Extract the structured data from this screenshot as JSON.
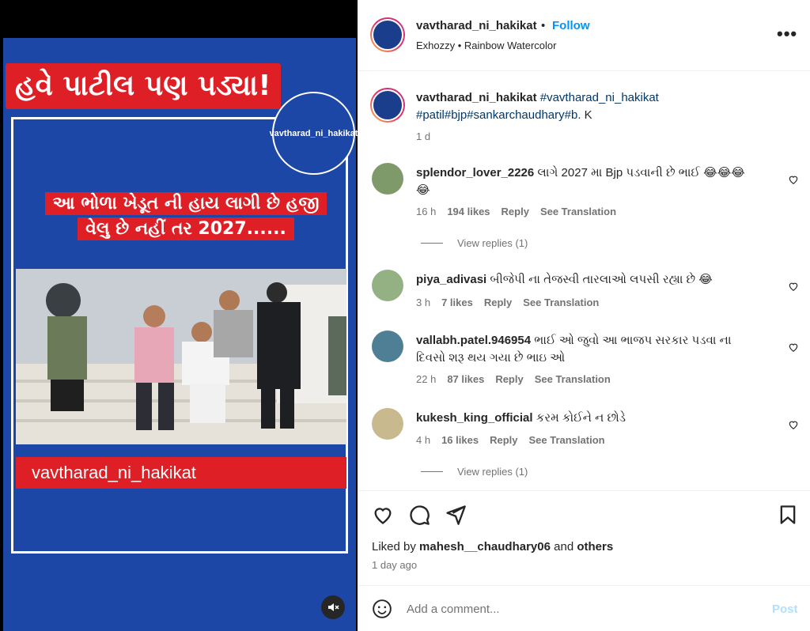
{
  "media": {
    "headline": "હવે પાટીલ પણ પડ્યા!",
    "logo_text": "vavtharad_ni_hakikat",
    "subtitle_line1": "આ ભોળા ખેડૂત ની હાય લાગી છે હજી",
    "subtitle_line2": "વેલુ છે નહીં તર 2027......",
    "watermark": "vavtharad_ni_hakikat",
    "mute_icon": "speaker-muted-icon"
  },
  "header": {
    "username": "vavtharad_ni_hakikat",
    "separator": "•",
    "follow_label": "Follow",
    "audio": "Exhozzy • Rainbow Watercolor",
    "more_label": "•••"
  },
  "caption": {
    "username": "vavtharad_ni_hakikat",
    "tag1": "#vavtharad_ni_hakikat",
    "tags2": "#patil#bjp#sankarchaudhary",
    "tag3": "#b",
    "tail": ". K",
    "time": "1 d"
  },
  "comments": [
    {
      "username": "splendor_lover_2226",
      "text_line1": "લાગે 2027 મા Bjp પડવાની છે ભાઈ 😂😂😂",
      "text_line2": "😂",
      "time": "16 h",
      "likes": "194 likes",
      "reply": "Reply",
      "translate": "See Translation",
      "view_replies": "View replies (1)"
    },
    {
      "username": "piya_adivasi",
      "text_line1": "બીજેપી ના તેજસ્વી તારલાઓ લપસી રહ્યા છે 😂",
      "time": "3 h",
      "likes": "7 likes",
      "reply": "Reply",
      "translate": "See Translation"
    },
    {
      "username": "vallabh.patel.946954",
      "text_line1": "ભાઈ ઓ જુવો આ ભાજપ સરકાર પડવા ના",
      "text_line2": "દિવસો શરૂ થય ગયા છે ભાઇ ઓ",
      "time": "22 h",
      "likes": "87 likes",
      "reply": "Reply",
      "translate": "See Translation"
    },
    {
      "username": "kukesh_king_official",
      "text_line1": "કરમ કોઈને ન છોડે",
      "time": "4 h",
      "likes": "16 likes",
      "reply": "Reply",
      "translate": "See Translation",
      "view_replies": "View replies (1)"
    }
  ],
  "actions": {
    "liked_by_prefix": "Liked by",
    "liked_by_user": "mahesh__chaudhary06",
    "and": "and",
    "others": "others",
    "ago": "1 day ago"
  },
  "composer": {
    "placeholder": "Add a comment...",
    "post_label": "Post"
  },
  "colors": {
    "accent": "#0095f6",
    "media_blue": "#1d47a6",
    "media_red": "#df1f26"
  }
}
